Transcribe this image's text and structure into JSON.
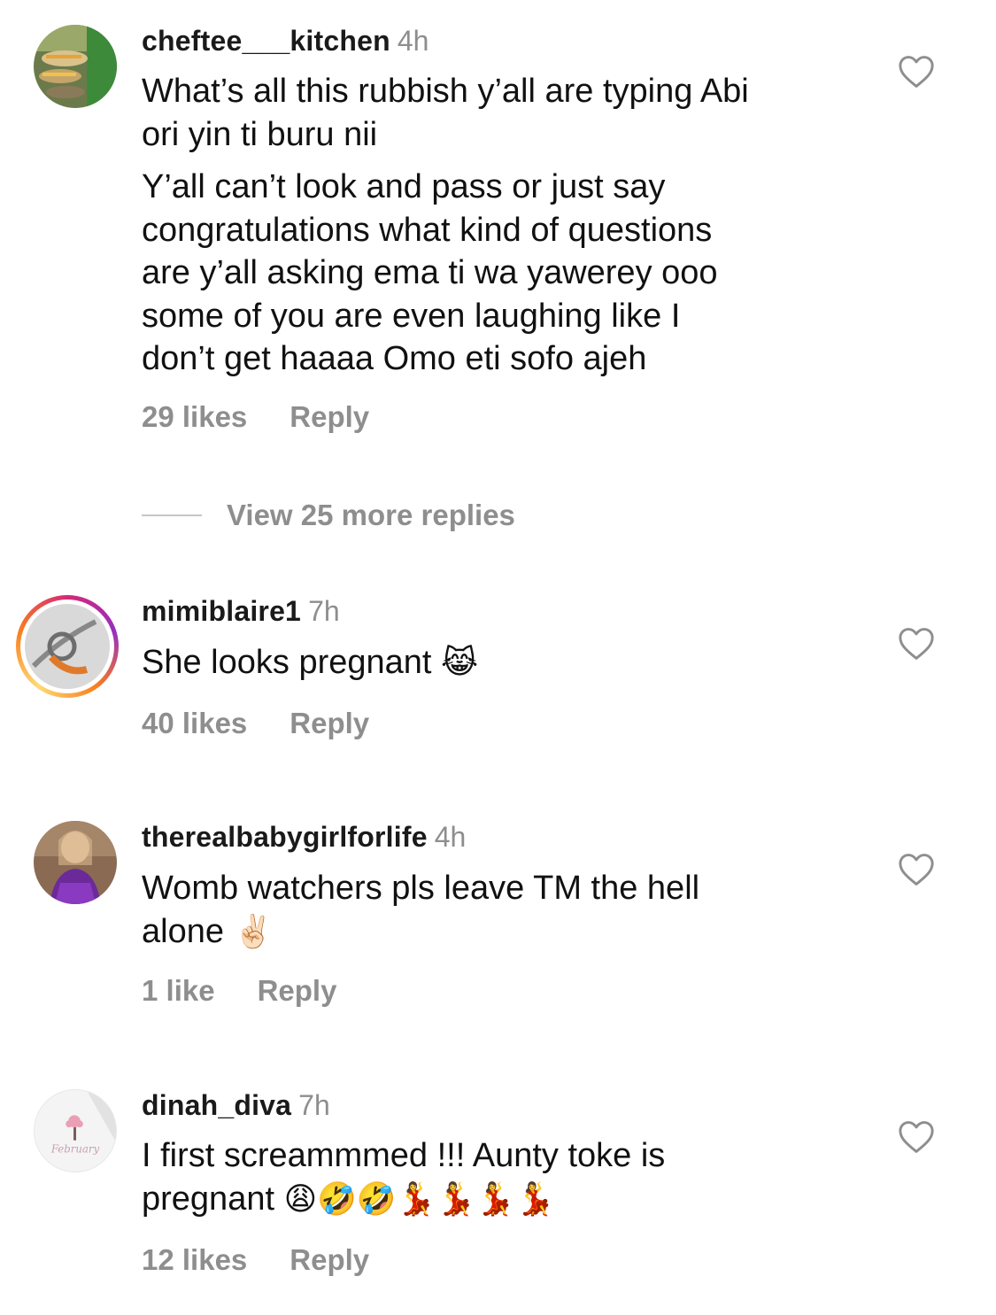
{
  "comments": [
    {
      "username": "cheftee___kitchen",
      "time": "4h",
      "text_lines": [
        "What’s all this rubbish y’all are typing Abi",
        "ori yin ti buru nii"
      ],
      "text2_lines": [
        "Y’all can’t look and pass or just say",
        "congratulations what kind of questions",
        "are y’all asking ema ti wa yawerey ooo",
        "some of you are even laughing like I",
        "don’t get haaaa Omo eti sofo ajeh"
      ],
      "likes": "29 likes",
      "reply": "Reply"
    },
    {
      "username": "mimiblaire1",
      "time": "7h",
      "text": "She looks pregnant",
      "emoji": "😹",
      "likes": "40 likes",
      "reply": "Reply"
    },
    {
      "username": "therealbabygirlforlife",
      "time": "4h",
      "line1": "Womb watchers pls leave TM the hell",
      "line2": "alone",
      "emoji": "✌🏻",
      "likes": "1 like",
      "reply": "Reply"
    },
    {
      "username": "dinah_diva",
      "time": "7h",
      "line1": "I first screammmed !!! Aunty toke is",
      "line2": "pregnant",
      "emoji": "😩🤣🤣💃💃💃💃",
      "likes": "12 likes",
      "reply": "Reply"
    }
  ],
  "view_more": "View 25 more replies",
  "avatar4_caption": "February",
  "colors": {
    "secondary_text": "#8e8e8e",
    "story_ring": [
      "#d62976",
      "#962fbf",
      "#fa7e1e",
      "#feda75"
    ]
  }
}
